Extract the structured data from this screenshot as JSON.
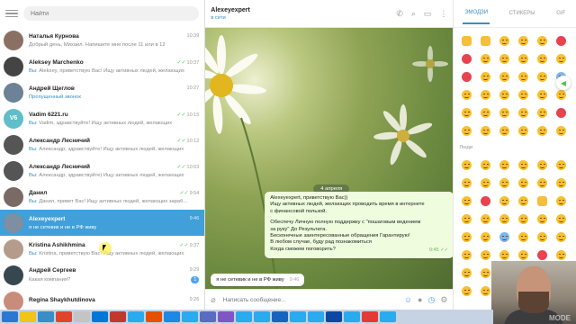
{
  "sidebar": {
    "search_placeholder": "Найти",
    "chats": [
      {
        "name": "Наталья Курнова",
        "time": "10:39",
        "preview_you": "",
        "preview": "Добрый день, Михаил. Напишите мне после 11 или в 12",
        "avatar": "avatar-photo",
        "color": "#8a6f63",
        "active": false,
        "check": false,
        "badge": ""
      },
      {
        "name": "Aleksey Marchenko",
        "time": "10:37",
        "preview_you": "Вы:",
        "preview": "Aleksey, приветствую Вас! Ищу активных людей, желающих",
        "avatar": "avatar-photo",
        "color": "#444",
        "active": false,
        "check": true,
        "badge": ""
      },
      {
        "name": "Андрей Щеглов",
        "time": "10:27",
        "preview_you": "",
        "preview": "Пропущенный звонок",
        "avatar": "avatar-photo",
        "color": "#6c8296",
        "active": false,
        "check": false,
        "badge": "",
        "missed": true
      },
      {
        "name": "Vadim 6221.ru",
        "time": "10:15",
        "preview_you": "Вы:",
        "preview": "Vadim, здравствуйте! Ищу активных людей, желающих",
        "avatar": "V6",
        "color": "#5fbec8",
        "active": false,
        "check": true,
        "badge": ""
      },
      {
        "name": "Александр Лесничий",
        "time": "10:12",
        "preview_you": "Вы:",
        "preview": "Александр, здравствуйте! Ищу активных людей, желающих",
        "avatar": "avatar-photo",
        "color": "#555",
        "active": false,
        "check": true,
        "badge": ""
      },
      {
        "name": "Александр Лесничий",
        "time": "10:03",
        "preview_you": "Вы:",
        "preview": "Александр, здравствуйте) Ищу активных людей, желающих",
        "avatar": "avatar-photo",
        "color": "#555",
        "active": false,
        "check": true,
        "badge": ""
      },
      {
        "name": "Данил",
        "time": "9:54",
        "preview_you": "Вы:",
        "preview": "Данил, привет Вас! Ищу активных людей, желающих зараб...",
        "avatar": "avatar-photo",
        "color": "#7a6a66",
        "active": false,
        "check": true,
        "badge": ""
      },
      {
        "name": "Alexeyexpert",
        "time": "9:46",
        "preview_you": "",
        "preview": "я не сетевик и не в РФ живу",
        "avatar": "avatar-photo",
        "color": "#7d8fa0",
        "active": true,
        "check": false,
        "badge": ""
      },
      {
        "name": "Kristina Ashikhmina",
        "time": "9:37",
        "preview_you": "Вы:",
        "preview": "Kristina, приветствую Вас! Ищу активных людей, желающих",
        "avatar": "avatar-photo",
        "color": "#b49b8a",
        "active": false,
        "check": true,
        "badge": ""
      },
      {
        "name": "Андрей Сергеев",
        "time": "9:29",
        "preview_you": "",
        "preview": "Какая компания?",
        "avatar": "avatar-photo",
        "color": "#37474f",
        "active": false,
        "check": false,
        "badge": "1"
      },
      {
        "name": "Regina Shaykhutdinova",
        "time": "9:26",
        "preview_you": "",
        "preview": "",
        "avatar": "avatar-photo",
        "color": "#c88d7a",
        "active": false,
        "check": false,
        "badge": ""
      }
    ]
  },
  "header": {
    "name": "Alexeyexpert",
    "status": "в сети"
  },
  "conversation": {
    "date": "4 апреля",
    "outgoing_lines": [
      "Alexeyexpert, приветствую Вас))",
      "Ищу активных людей, желающих проводить время в интернете",
      "с финансовой пользой.",
      "",
      "Обеспечу Личную полную поддержку с \"пошаговым ведением",
      "за руку\" До Результата.",
      "Бесконечные заинтересованные обращения Гарантирую!",
      "В любом случае, буду рад познакомиться",
      "Когда сможем поговорить?"
    ],
    "outgoing_time": "9:45",
    "incoming_text": "я не сетевик и не в РФ живу",
    "incoming_time": "9:46",
    "composer_placeholder": "Написать сообщение..."
  },
  "emoji_panel": {
    "tabs": [
      "ЭМОДЗИ",
      "СТИКЕРЫ",
      "GIF"
    ],
    "section_people": "Люди"
  },
  "webcam": {
    "overlay": "MODE"
  }
}
